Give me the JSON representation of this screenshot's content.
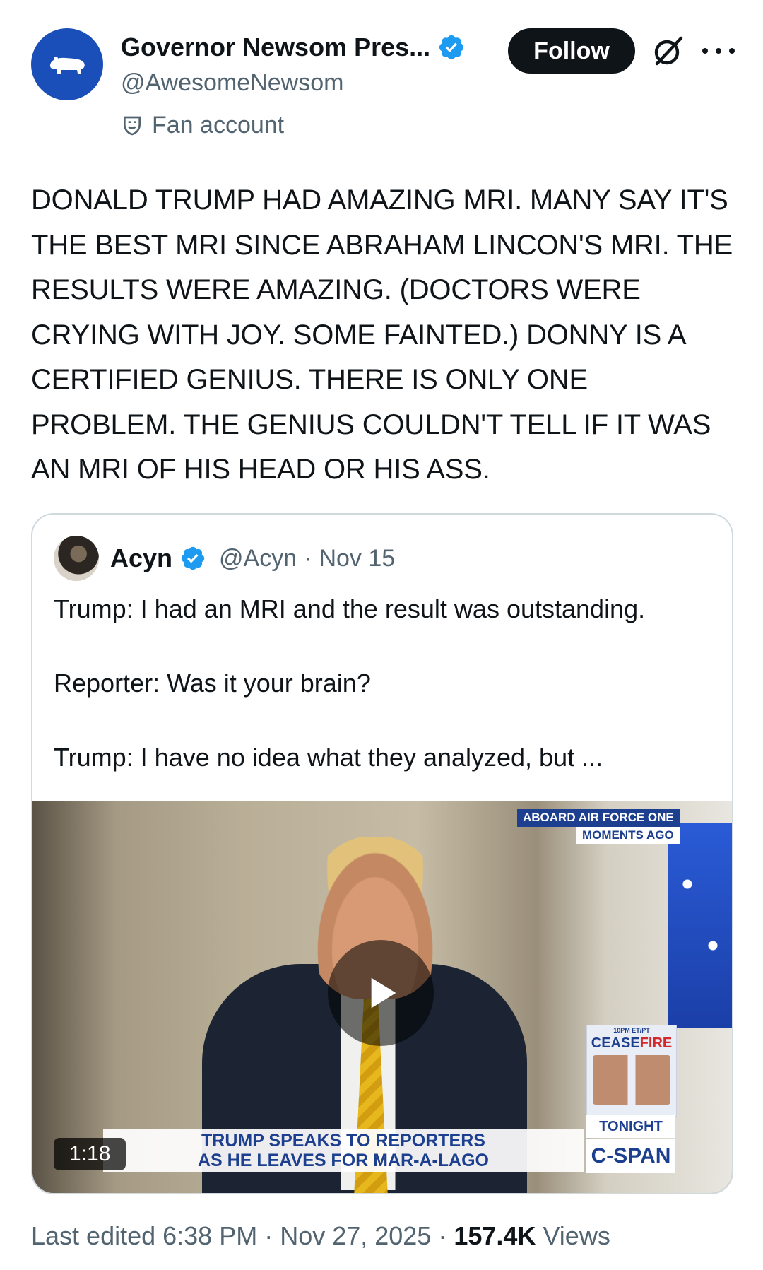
{
  "author": {
    "display_name": "Governor Newsom Pres...",
    "handle": "@AwesomeNewsom",
    "label": "Fan account",
    "verified": true
  },
  "actions": {
    "follow_label": "Follow"
  },
  "tweet": {
    "text": "DONALD TRUMP HAD AMAZING MRI. MANY SAY IT'S THE BEST MRI SINCE ABRAHAM LINCON'S MRI. THE RESULTS WERE AMAZING. (DOCTORS WERE CRYING WITH JOY. SOME FAINTED.) DONNY IS A CERTIFIED GENIUS. THERE IS ONLY ONE PROBLEM. THE GENIUS COULDN'T TELL IF IT WAS AN MRI OF HIS HEAD OR HIS ASS."
  },
  "quote": {
    "name": "Acyn",
    "handle": "@Acyn",
    "date": "Nov 15",
    "paragraphs": [
      "Trump: I had an MRI and the result was outstanding.",
      "Reporter: Was it your brain?",
      "Trump: I have no idea what they analyzed, but ..."
    ],
    "video": {
      "duration": "1:18",
      "chyron_top": "ABOARD AIR FORCE ONE",
      "chyron_sub": "MOMENTS AGO",
      "lower_third_line1": "TRUMP SPEAKS TO REPORTERS",
      "lower_third_line2": "AS HE LEAVES FOR MAR-A-LAGO",
      "promo_time": "10PM ET/PT",
      "promo_word_a": "CEASE",
      "promo_word_b": "FIRE",
      "promo_tonight": "TONIGHT",
      "network": "C-SPAN"
    }
  },
  "footer": {
    "edited": "Last edited 6:38 PM · Nov 27, 2025 · ",
    "views_count": "157.4K",
    "views_label": " Views"
  },
  "colors": {
    "verified_blue": "#1d9bf0",
    "avatar_blue": "#1a4eb8",
    "secondary_text": "#536471"
  }
}
